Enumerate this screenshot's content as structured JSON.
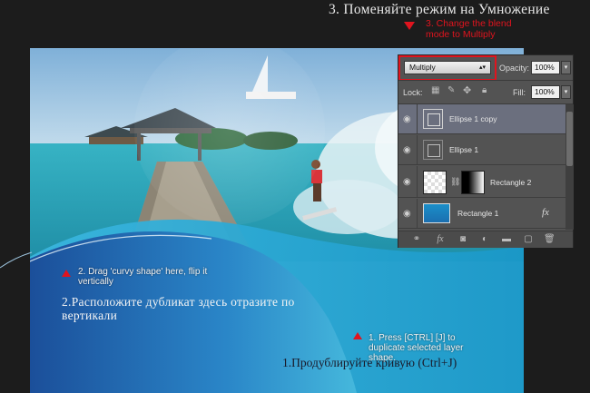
{
  "instructions": {
    "step3_ru": "3. Поменяйте режим на Умножение",
    "step3_en": "3. Change the blend mode to Multiply",
    "step2_en": "2. Drag 'curvy shape' here, flip it vertically",
    "step2_ru": "2.Расположите дубликат здесь отразите по вертикали",
    "step1_en": "1. Press [CTRL] [J] to duplicate selected layer shape.",
    "step1_ru": "1.Продублируйте кривую (Ctrl+J)"
  },
  "layers_panel": {
    "blend_mode": "Multiply",
    "opacity_label": "Opacity:",
    "opacity_value": "100%",
    "lock_label": "Lock:",
    "fill_label": "Fill:",
    "fill_value": "100%",
    "layers": [
      {
        "name": "Ellipse 1 copy",
        "selected": true
      },
      {
        "name": "Ellipse 1",
        "selected": false
      },
      {
        "name": "Rectangle 2",
        "selected": false
      },
      {
        "name": "Rectangle 1",
        "selected": false,
        "fx": "fx"
      }
    ],
    "bottom_icons": [
      "link-icon",
      "fx-icon",
      "mask-icon",
      "adjustment-icon",
      "group-folder-icon",
      "new-layer-icon",
      "trash-icon"
    ]
  },
  "colors": {
    "accent_red": "#e0141e",
    "selected_layer": "#6b6f7e",
    "panel_bg": "#535353"
  }
}
